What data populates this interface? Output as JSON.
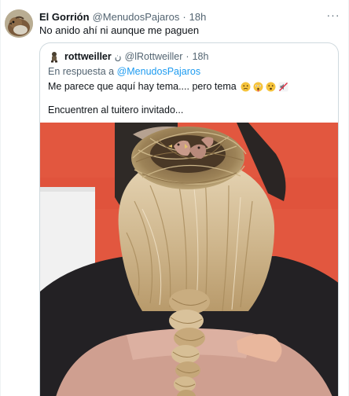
{
  "tweet": {
    "display_name": "El Gorrión",
    "handle": "@MenudosPajaros",
    "separator": "·",
    "time": "18h",
    "text": "No anido ahí ni aunque me paguen",
    "more_label": "···"
  },
  "quote": {
    "display_name": "rottweiller",
    "name_suffix": "ن",
    "handle": "@lRottweiller",
    "separator": "·",
    "time": "18h",
    "reply_prefix": "En respuesta a",
    "reply_mention": "@MenudosPajaros",
    "text_line1": "Me parece que aquí hay tema.... pero tema",
    "text_line2": "Encuentren al tuitero invitado...",
    "emojis": [
      "worried-face-icon",
      "flushed-face-icon",
      "open-mouth-face-icon",
      "muted-speaker-icon"
    ]
  },
  "colors": {
    "text_primary": "#0f1419",
    "text_secondary": "#536471",
    "link": "#1d9bf0",
    "border": "#cfd9de",
    "photo_background": "#e2573f"
  }
}
